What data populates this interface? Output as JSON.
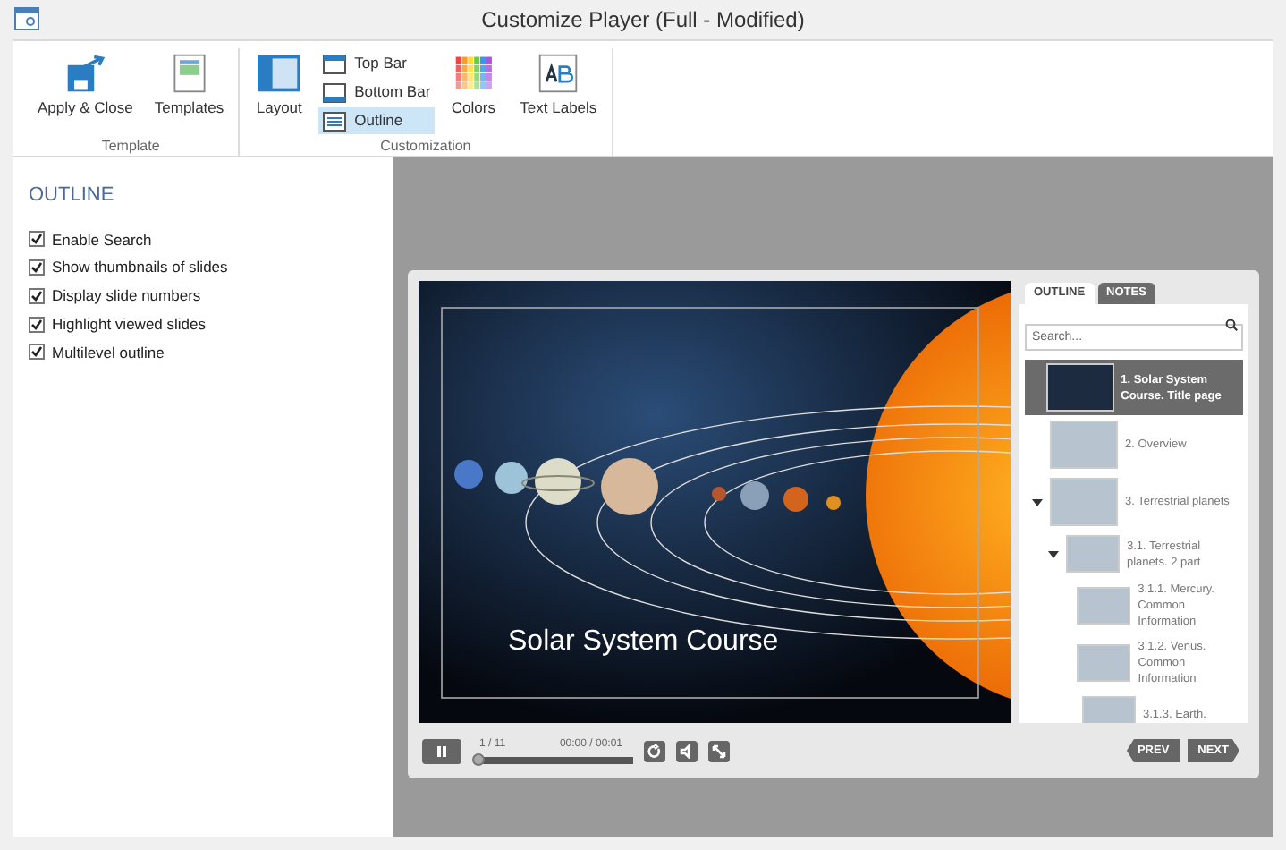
{
  "window": {
    "title": "Customize Player (Full - Modified)"
  },
  "ribbon": {
    "groups": [
      {
        "label": "Template",
        "items": [
          {
            "kind": "large",
            "label": "Apply & Close",
            "selected": false
          },
          {
            "kind": "large",
            "label": "Templates",
            "selected": false
          }
        ]
      },
      {
        "label": "Customization",
        "items": [
          {
            "kind": "large",
            "label": "Layout",
            "selected": false
          },
          {
            "kind": "small",
            "label": "Top Bar",
            "selected": false
          },
          {
            "kind": "small",
            "label": "Bottom Bar",
            "selected": false
          },
          {
            "kind": "small",
            "label": "Outline",
            "selected": true
          },
          {
            "kind": "large",
            "label": "Colors",
            "selected": false
          },
          {
            "kind": "large",
            "label": "Text Labels",
            "selected": false
          }
        ]
      }
    ]
  },
  "panel": {
    "heading": "OUTLINE",
    "options": [
      {
        "label": "Enable Search",
        "checked": true
      },
      {
        "label": "Show thumbnails of slides",
        "checked": true
      },
      {
        "label": "Display slide numbers",
        "checked": true
      },
      {
        "label": "Highlight viewed slides",
        "checked": true
      },
      {
        "label": "Multilevel outline",
        "checked": true
      }
    ]
  },
  "player": {
    "slide_title": "Solar System Course",
    "tabs": [
      {
        "label": "OUTLINE",
        "selected": true
      },
      {
        "label": "NOTES",
        "selected": false
      }
    ],
    "search": {
      "placeholder": "Search..."
    },
    "outline": [
      {
        "label": "1. Solar System Course. Title page",
        "selected": true,
        "expanded": false
      },
      {
        "label": "2. Overview",
        "selected": false,
        "expanded": false
      },
      {
        "label": "3. Terrestrial planets",
        "selected": false,
        "expanded": true,
        "children": [
          {
            "label": "3.1. Terrestrial planets. 2 part",
            "selected": false,
            "expanded": true,
            "children": [
              {
                "label": "3.1.1. Mercury. Common Information",
                "selected": false,
                "expanded": false
              },
              {
                "label": "3.1.2. Venus. Common Information",
                "selected": false,
                "expanded": false
              },
              {
                "label": "3.1.3. Earth.",
                "selected": false,
                "expanded": false
              }
            ]
          }
        ]
      }
    ],
    "slide_counter": "1 / 11",
    "time": "00:00 / 00:01",
    "progress": {
      "level": 0.02
    },
    "prev": "PREV",
    "next": "NEXT"
  }
}
